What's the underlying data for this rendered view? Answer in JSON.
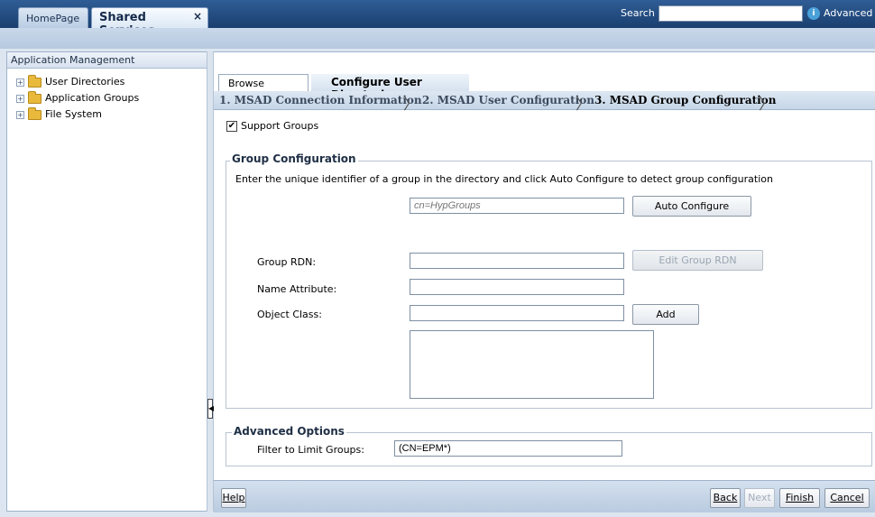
{
  "top_tabs": [
    {
      "label": "HomePage"
    },
    {
      "label": "Shared Services",
      "close": "×"
    }
  ],
  "search": {
    "label": "Search",
    "value": "",
    "advanced_label": "Advanced",
    "advanced_icon": "i"
  },
  "left_panel": {
    "title": "Application Management",
    "tree": [
      {
        "label": "User Directories",
        "expander": "+"
      },
      {
        "label": "Application Groups",
        "expander": "+"
      },
      {
        "label": "File System",
        "expander": "+"
      }
    ]
  },
  "splitter": {
    "arrow": "◀"
  },
  "inner_tabs": [
    {
      "label": "Browse"
    },
    {
      "label": "Configure User Directories"
    }
  ],
  "steps": [
    {
      "label": "1. MSAD Connection Information",
      "chev": "〉"
    },
    {
      "label": "2. MSAD User Configuration",
      "chev": "〉"
    },
    {
      "label": "3. MSAD Group Configuration",
      "chev": "〉"
    }
  ],
  "support_groups": {
    "label": "Support Groups",
    "check": "✔"
  },
  "group_config": {
    "legend": "Group Configuration",
    "instructions": "Enter the unique identifier of a group in the directory and click Auto Configure to detect group configuration",
    "identifier_placeholder": "cn=HypGroups",
    "auto_configure_label": "Auto Configure",
    "group_rdn_label": "Group RDN:",
    "group_rdn_value": "",
    "edit_group_rdn_label": "Edit Group RDN",
    "name_attribute_label": "Name Attribute:",
    "name_attribute_value": "",
    "object_class_label": "Object Class:",
    "object_class_value": "",
    "add_label": "Add"
  },
  "advanced_options": {
    "legend": "Advanced Options",
    "filter_label": "Filter to Limit Groups:",
    "filter_value": "(CN=EPM*)"
  },
  "footer": {
    "help": "Help",
    "back": "Back",
    "next": "Next",
    "finish": "Finish",
    "cancel": "Cancel"
  },
  "colors": {
    "topbar": "#1b3f70",
    "accent": "#4aa0d8",
    "panel": "#dde6f0"
  }
}
